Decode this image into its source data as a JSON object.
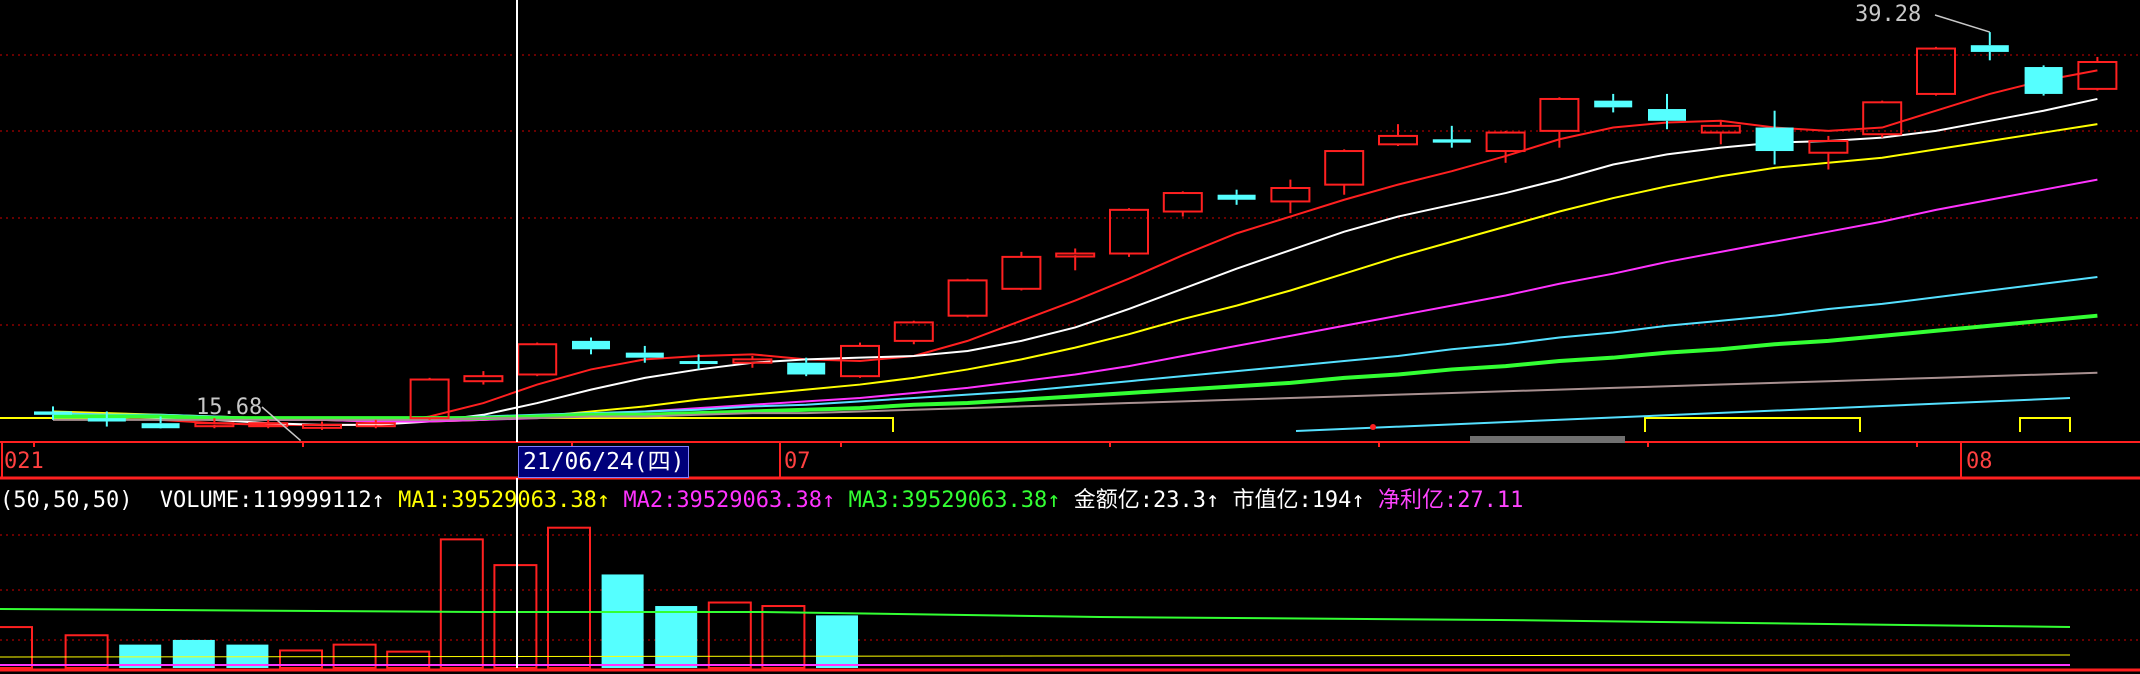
{
  "chart_data": [
    {
      "type": "candlestick",
      "name": "price-panel",
      "price_range": [
        15.0,
        40.0
      ],
      "max_label": "39.28",
      "min_label": "15.68",
      "x_axis_labels": [
        {
          "text": "021",
          "index": 0
        },
        {
          "text": "07",
          "index": 14
        },
        {
          "text": "08",
          "index": 36
        }
      ],
      "crosshair_date": "21/06/24(四)",
      "crosshair_index": 9,
      "candles": [
        {
          "o": 16.7,
          "h": 17.0,
          "l": 16.2,
          "c": 16.5
        },
        {
          "o": 16.3,
          "h": 16.7,
          "l": 15.8,
          "c": 16.1
        },
        {
          "o": 16.0,
          "h": 16.4,
          "l": 15.68,
          "c": 15.7
        },
        {
          "o": 15.9,
          "h": 16.3,
          "l": 15.7,
          "c": 16.0
        },
        {
          "o": 15.9,
          "h": 16.2,
          "l": 15.7,
          "c": 16.0
        },
        {
          "o": 15.8,
          "h": 16.1,
          "l": 15.6,
          "c": 15.9
        },
        {
          "o": 15.9,
          "h": 16.2,
          "l": 15.7,
          "c": 16.0
        },
        {
          "o": 16.3,
          "h": 18.7,
          "l": 16.2,
          "c": 18.6
        },
        {
          "o": 18.5,
          "h": 19.1,
          "l": 18.3,
          "c": 18.8
        },
        {
          "o": 18.9,
          "h": 20.8,
          "l": 18.8,
          "c": 20.7
        },
        {
          "o": 20.9,
          "h": 21.1,
          "l": 20.1,
          "c": 20.4
        },
        {
          "o": 20.2,
          "h": 20.6,
          "l": 19.6,
          "c": 19.9
        },
        {
          "o": 19.7,
          "h": 20.1,
          "l": 19.2,
          "c": 19.6
        },
        {
          "o": 19.6,
          "h": 20.0,
          "l": 19.3,
          "c": 19.8
        },
        {
          "o": 19.6,
          "h": 19.9,
          "l": 18.8,
          "c": 18.9
        },
        {
          "o": 18.8,
          "h": 20.8,
          "l": 18.7,
          "c": 20.6
        },
        {
          "o": 20.9,
          "h": 22.1,
          "l": 20.7,
          "c": 22.0
        },
        {
          "o": 22.4,
          "h": 24.6,
          "l": 22.3,
          "c": 24.5
        },
        {
          "o": 24.0,
          "h": 26.2,
          "l": 23.9,
          "c": 25.9
        },
        {
          "o": 26.0,
          "h": 26.4,
          "l": 25.1,
          "c": 26.1
        },
        {
          "o": 26.1,
          "h": 28.8,
          "l": 25.9,
          "c": 28.7
        },
        {
          "o": 28.6,
          "h": 29.8,
          "l": 28.3,
          "c": 29.7
        },
        {
          "o": 29.6,
          "h": 29.9,
          "l": 29.0,
          "c": 29.3
        },
        {
          "o": 29.2,
          "h": 30.5,
          "l": 28.5,
          "c": 30.0
        },
        {
          "o": 30.2,
          "h": 32.3,
          "l": 29.6,
          "c": 32.2
        },
        {
          "o": 32.6,
          "h": 33.8,
          "l": 32.5,
          "c": 33.1
        },
        {
          "o": 32.9,
          "h": 33.7,
          "l": 32.4,
          "c": 32.7
        },
        {
          "o": 32.2,
          "h": 33.4,
          "l": 31.5,
          "c": 33.3
        },
        {
          "o": 33.4,
          "h": 35.4,
          "l": 32.4,
          "c": 35.3
        },
        {
          "o": 35.2,
          "h": 35.6,
          "l": 34.5,
          "c": 34.8
        },
        {
          "o": 34.7,
          "h": 35.6,
          "l": 33.5,
          "c": 34.0
        },
        {
          "o": 33.3,
          "h": 34.0,
          "l": 32.6,
          "c": 33.7
        },
        {
          "o": 33.6,
          "h": 34.6,
          "l": 31.4,
          "c": 32.2
        },
        {
          "o": 32.1,
          "h": 33.1,
          "l": 31.1,
          "c": 32.8
        },
        {
          "o": 33.2,
          "h": 35.2,
          "l": 33.0,
          "c": 35.1
        },
        {
          "o": 35.6,
          "h": 38.4,
          "l": 35.5,
          "c": 38.3
        },
        {
          "o": 38.5,
          "h": 39.28,
          "l": 37.6,
          "c": 38.1
        },
        {
          "o": 37.2,
          "h": 37.3,
          "l": 35.5,
          "c": 35.6
        },
        {
          "o": 35.9,
          "h": 37.8,
          "l": 35.8,
          "c": 37.5
        }
      ],
      "ma_lines": [
        {
          "color": "#ff2020",
          "values": [
            16.6,
            16.4,
            16.2,
            16.0,
            15.9,
            15.9,
            15.9,
            16.4,
            17.2,
            18.3,
            19.2,
            19.8,
            20.0,
            20.1,
            19.8,
            19.7,
            20.0,
            20.9,
            22.1,
            23.3,
            24.6,
            26.0,
            27.3,
            28.3,
            29.3,
            30.2,
            31.0,
            31.9,
            32.9,
            33.6,
            33.9,
            34.0,
            33.6,
            33.4,
            33.6,
            34.6,
            35.6,
            36.4,
            37.0
          ]
        },
        {
          "color": "#ffffff",
          "values": [
            16.5,
            16.4,
            16.3,
            16.2,
            16.0,
            15.9,
            15.9,
            16.1,
            16.5,
            17.2,
            18.0,
            18.7,
            19.2,
            19.6,
            19.8,
            19.9,
            20.0,
            20.3,
            20.9,
            21.7,
            22.8,
            24.0,
            25.2,
            26.3,
            27.4,
            28.3,
            29.0,
            29.7,
            30.5,
            31.4,
            32.0,
            32.4,
            32.7,
            32.8,
            33.0,
            33.4,
            34.0,
            34.6,
            35.3
          ]
        },
        {
          "color": "#ffff00",
          "values": [
            16.7,
            16.6,
            16.5,
            16.4,
            16.3,
            16.2,
            16.1,
            16.1,
            16.2,
            16.4,
            16.7,
            17.0,
            17.4,
            17.7,
            18.0,
            18.3,
            18.7,
            19.2,
            19.8,
            20.5,
            21.3,
            22.2,
            23.0,
            23.9,
            24.9,
            25.9,
            26.8,
            27.7,
            28.6,
            29.4,
            30.1,
            30.7,
            31.2,
            31.5,
            31.8,
            32.3,
            32.8,
            33.3,
            33.8
          ]
        },
        {
          "color": "#ff33ff",
          "values": [
            16.6,
            16.5,
            16.4,
            16.3,
            16.2,
            16.2,
            16.1,
            16.1,
            16.2,
            16.3,
            16.5,
            16.7,
            16.9,
            17.1,
            17.3,
            17.5,
            17.8,
            18.1,
            18.5,
            18.9,
            19.4,
            20.0,
            20.6,
            21.2,
            21.8,
            22.4,
            23.0,
            23.6,
            24.3,
            24.9,
            25.6,
            26.2,
            26.8,
            27.4,
            28.0,
            28.7,
            29.3,
            29.9,
            30.5
          ]
        },
        {
          "color": "#55e0ff",
          "values": [
            16.6,
            16.5,
            16.5,
            16.4,
            16.3,
            16.3,
            16.3,
            16.3,
            16.4,
            16.5,
            16.6,
            16.7,
            16.8,
            17.0,
            17.1,
            17.3,
            17.5,
            17.7,
            17.9,
            18.2,
            18.5,
            18.8,
            19.1,
            19.4,
            19.7,
            20.0,
            20.4,
            20.7,
            21.1,
            21.4,
            21.8,
            22.1,
            22.4,
            22.8,
            23.1,
            23.5,
            23.9,
            24.3,
            24.7
          ]
        },
        {
          "color": "#33ff33",
          "values": [
            16.4,
            16.4,
            16.4,
            16.3,
            16.3,
            16.3,
            16.3,
            16.3,
            16.3,
            16.4,
            16.5,
            16.5,
            16.6,
            16.7,
            16.8,
            16.9,
            17.1,
            17.2,
            17.4,
            17.6,
            17.8,
            18.0,
            18.2,
            18.4,
            18.7,
            18.9,
            19.2,
            19.4,
            19.7,
            19.9,
            20.2,
            20.4,
            20.7,
            20.9,
            21.2,
            21.5,
            21.8,
            22.1,
            22.4
          ]
        },
        {
          "color": "#a89090",
          "values": [
            16.2,
            16.2,
            16.2,
            16.2,
            16.2,
            16.2,
            16.2,
            16.2,
            16.3,
            16.3,
            16.4,
            16.4,
            16.5,
            16.6,
            16.6,
            16.7,
            16.8,
            16.9,
            17.0,
            17.1,
            17.2,
            17.3,
            17.4,
            17.5,
            17.6,
            17.7,
            17.8,
            17.9,
            18.0,
            18.1,
            18.2,
            18.3,
            18.4,
            18.5,
            18.6,
            18.7,
            18.8,
            18.9,
            19.0
          ]
        }
      ]
    },
    {
      "type": "bar",
      "name": "volume-panel",
      "volume_range": [
        0,
        130000000
      ],
      "values": [
        35000000,
        28000000,
        20000000,
        24000000,
        20000000,
        15000000,
        20000000,
        14000000,
        110000000,
        88000000,
        120000000,
        80000000,
        53000000,
        56000000,
        53000000,
        45000000
      ],
      "up": [
        true,
        true,
        false,
        false,
        false,
        true,
        true,
        true,
        true,
        true,
        true,
        false,
        false,
        true,
        true,
        false
      ],
      "ma_level": 39529063.38
    }
  ],
  "volume_legend": {
    "params": "(50,50,50)",
    "volume_label": "VOLUME:",
    "volume_value": "119999112",
    "arrow": "↑",
    "ma1_label": "MA1:",
    "ma1_value": "39529063.38",
    "ma2_label": "MA2:",
    "ma2_value": "39529063.38",
    "ma3_label": "MA3:",
    "ma3_value": "39529063.38",
    "amount_label": "金额亿:",
    "amount_value": "23.3",
    "mktcap_label": "市值亿:",
    "mktcap_value": "194",
    "profit_label": "净利亿:",
    "profit_value": "27.11"
  },
  "colors": {
    "up": "#ff2020",
    "down": "#55ffff",
    "grid": "#8b0000",
    "axis": "#ff2020"
  }
}
